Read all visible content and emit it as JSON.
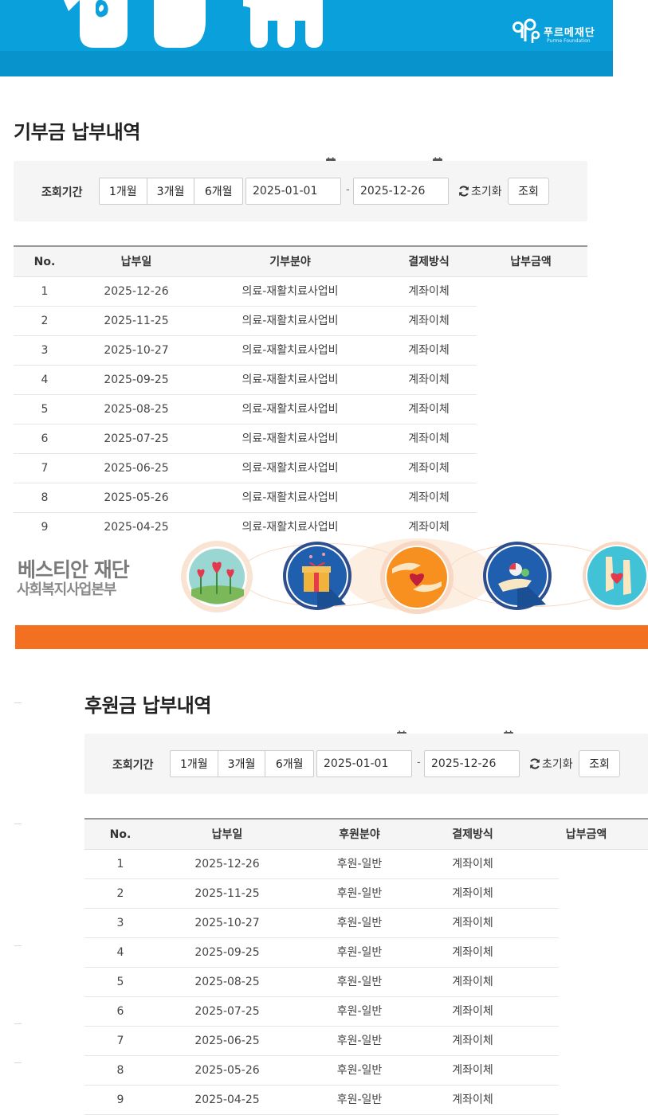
{
  "top_banner": {
    "org_name": "푸르메재단",
    "org_english": "Purme Foundation",
    "bg_color": "#0aa0dc"
  },
  "donation_section": {
    "title": "기부금 납부내역",
    "filter": {
      "label": "조회기간",
      "periods": [
        "1개월",
        "3개월",
        "6개월"
      ],
      "start_date": "2025-01-01",
      "end_date": "2025-12-26",
      "separator": "-",
      "reset_label": "초기화",
      "search_label": "조회"
    },
    "table": {
      "headers": [
        "No.",
        "납부일",
        "기부분야",
        "결제방식",
        "납부금액"
      ],
      "rows": [
        {
          "no": "1",
          "date": "2025-12-26",
          "field": "의료-재활치료사업비",
          "method": "계좌이체"
        },
        {
          "no": "2",
          "date": "2025-11-25",
          "field": "의료-재활치료사업비",
          "method": "계좌이체"
        },
        {
          "no": "3",
          "date": "2025-10-27",
          "field": "의료-재활치료사업비",
          "method": "계좌이체"
        },
        {
          "no": "4",
          "date": "2025-09-25",
          "field": "의료-재활치료사업비",
          "method": "계좌이체"
        },
        {
          "no": "5",
          "date": "2025-08-25",
          "field": "의료-재활치료사업비",
          "method": "계좌이체"
        },
        {
          "no": "6",
          "date": "2025-07-25",
          "field": "의료-재활치료사업비",
          "method": "계좌이체"
        },
        {
          "no": "7",
          "date": "2025-06-25",
          "field": "의료-재활치료사업비",
          "method": "계좌이체"
        },
        {
          "no": "8",
          "date": "2025-05-26",
          "field": "의료-재활치료사업비",
          "method": "계좌이체"
        },
        {
          "no": "9",
          "date": "2025-04-25",
          "field": "의료-재활치료사업비",
          "method": "계좌이체"
        }
      ]
    }
  },
  "middle_banner": {
    "title": "베스티안 재단",
    "subtitle": "사회복지사업본부",
    "accent_color": "#f47021"
  },
  "sponsor_section": {
    "title": "후원금 납부내역",
    "filter": {
      "label": "조회기간",
      "periods": [
        "1개월",
        "3개월",
        "6개월"
      ],
      "start_date": "2025-01-01",
      "end_date": "2025-12-26",
      "separator": "-",
      "reset_label": "초기화",
      "search_label": "조회"
    },
    "table": {
      "headers": [
        "No.",
        "납부일",
        "후원분야",
        "결제방식",
        "납부금액"
      ],
      "rows": [
        {
          "no": "1",
          "date": "2025-12-26",
          "field": "후원-일반",
          "method": "계좌이체"
        },
        {
          "no": "2",
          "date": "2025-11-25",
          "field": "후원-일반",
          "method": "계좌이체"
        },
        {
          "no": "3",
          "date": "2025-10-27",
          "field": "후원-일반",
          "method": "계좌이체"
        },
        {
          "no": "4",
          "date": "2025-09-25",
          "field": "후원-일반",
          "method": "계좌이체"
        },
        {
          "no": "5",
          "date": "2025-08-25",
          "field": "후원-일반",
          "method": "계좌이체"
        },
        {
          "no": "6",
          "date": "2025-07-25",
          "field": "후원-일반",
          "method": "계좌이체"
        },
        {
          "no": "7",
          "date": "2025-06-25",
          "field": "후원-일반",
          "method": "계좌이체"
        },
        {
          "no": "8",
          "date": "2025-05-26",
          "field": "후원-일반",
          "method": "계좌이체"
        },
        {
          "no": "9",
          "date": "2025-04-25",
          "field": "후원-일반",
          "method": "계좌이체"
        }
      ]
    }
  }
}
